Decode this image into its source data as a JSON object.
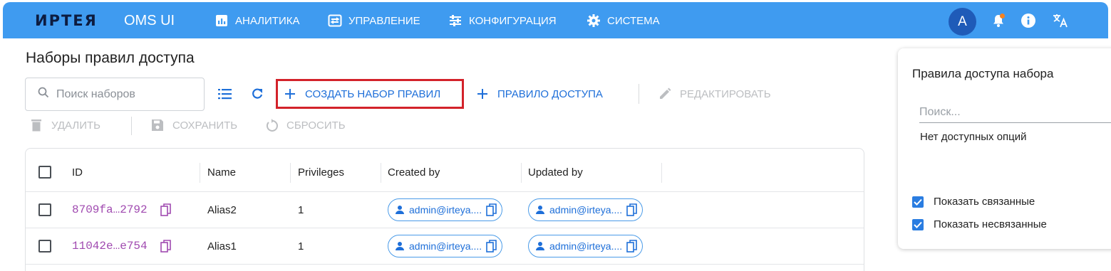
{
  "header": {
    "logo": "ИРТЕЯ",
    "app_name": "OMS UI",
    "nav": [
      {
        "label": "АНАЛИТИКА",
        "icon": "analytics-icon"
      },
      {
        "label": "УПРАВЛЕНИЕ",
        "icon": "management-icon"
      },
      {
        "label": "КОНФИГУРАЦИЯ",
        "icon": "sliders-icon"
      },
      {
        "label": "СИСТЕМА",
        "icon": "gear-icon"
      }
    ],
    "avatar_letter": "A"
  },
  "main": {
    "title": "Наборы правил доступа",
    "search_placeholder": "Поиск наборов",
    "toolbar": {
      "create_set": "СОЗДАТЬ НАБОР ПРАВИЛ",
      "access_rule": "ПРАВИЛО ДОСТУПА",
      "edit": "РЕДАКТИРОВАТЬ",
      "delete": "УДАЛИТЬ",
      "save": "СОХРАНИТЬ",
      "reset": "СБРОСИТЬ"
    },
    "table": {
      "columns": [
        "ID",
        "Name",
        "Privileges",
        "Created by",
        "Updated by"
      ],
      "rows": [
        {
          "id": "8709fa…2792",
          "name": "Alias2",
          "privileges": "1",
          "created_by": "admin@irteya....",
          "updated_by": "admin@irteya...."
        },
        {
          "id": "11042e…e754",
          "name": "Alias1",
          "privileges": "1",
          "created_by": "admin@irteya....",
          "updated_by": "admin@irteya...."
        }
      ]
    }
  },
  "side_panel": {
    "title": "Правила доступа набора",
    "search_placeholder": "Поиск...",
    "empty_text": "Нет доступных опций",
    "show_linked": "Показать связанные",
    "show_unlinked": "Показать несвязанные"
  },
  "colors": {
    "header_bg": "#3f9bf0",
    "accent": "#1e6fd9",
    "highlight_border": "#d3222a",
    "id_text": "#a04ab0",
    "notification_dot": "#f5821f"
  }
}
